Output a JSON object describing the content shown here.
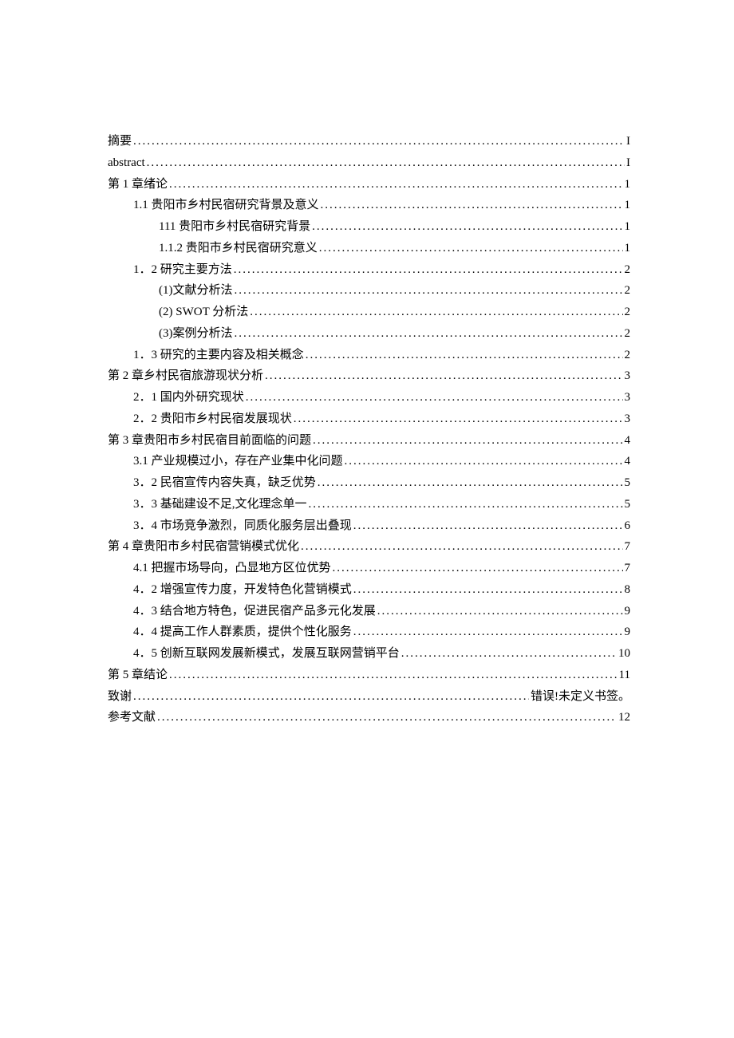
{
  "toc": [
    {
      "level": 0,
      "label": "摘要",
      "page": "I"
    },
    {
      "level": 0,
      "label": "abstract ",
      "page": "I"
    },
    {
      "level": 0,
      "label": "第 1 章绪论 ",
      "page": "1"
    },
    {
      "level": 1,
      "label": "1.1 贵阳市乡村民宿研究背景及意义 ",
      "page": "1"
    },
    {
      "level": 2,
      "label": "111 贵阳市乡村民宿研究背景 ",
      "page": "1"
    },
    {
      "level": 2,
      "label": "1.1.2 贵阳市乡村民宿研究意义 ",
      "page": "1"
    },
    {
      "level": 1,
      "label": "1．2 研究主要方法 ",
      "page": "2"
    },
    {
      "level": 2,
      "label": "(1)文献分析法",
      "page": "2"
    },
    {
      "level": 2,
      "label": "(2) SWOT 分析法",
      "page": "2"
    },
    {
      "level": 2,
      "label": "(3)案例分析法",
      "page": "2"
    },
    {
      "level": 1,
      "label": "1．3 研究的主要内容及相关概念 ",
      "page": "2"
    },
    {
      "level": 0,
      "label": "第 2 章乡村民宿旅游现状分析 ",
      "page": "3"
    },
    {
      "level": 1,
      "label": "2．1 国内外研究现状 ",
      "page": "3"
    },
    {
      "level": 1,
      "label": "2．2 贵阳市乡村民宿发展现状 ",
      "page": "3"
    },
    {
      "level": 0,
      "label": "第 3 章贵阳市乡村民宿目前面临的问题 ",
      "page": "4"
    },
    {
      "level": 1,
      "label": "3.1 产业规模过小，存在产业集中化问题 ",
      "page": "4"
    },
    {
      "level": 1,
      "label": "3．2 民宿宣传内容失真，缺乏优势 ",
      "page": "5"
    },
    {
      "level": 1,
      "label": "3．3 基础建设不足,文化理念单一 ",
      "page": "5"
    },
    {
      "level": 1,
      "label": "3．4 市场竞争激烈，同质化服务层出叠现 ",
      "page": "6"
    },
    {
      "level": 0,
      "label": "第 4 章贵阳市乡村民宿营销模式优化 ",
      "page": "7"
    },
    {
      "level": 1,
      "label": "4.1 把握市场导向，凸显地方区位优势 ",
      "page": "7"
    },
    {
      "level": 1,
      "label": "4．2 增强宣传力度，开发特色化营销模式 ",
      "page": "8"
    },
    {
      "level": 1,
      "label": "4．3 结合地方特色，促进民宿产品多元化发展 ",
      "page": "9"
    },
    {
      "level": 1,
      "label": "4．4 提高工作人群素质，提供个性化服务 ",
      "page": "9"
    },
    {
      "level": 1,
      "label": "4．5 创新互联网发展新模式，发展互联网营销平台 ",
      "page": "10"
    },
    {
      "level": 0,
      "label": "第 5 章结论 ",
      "page": "11"
    },
    {
      "level": 0,
      "label": "致谢",
      "page": "错误!未定义书签。"
    },
    {
      "level": 0,
      "label": "参考文献 ",
      "page": "12"
    }
  ]
}
